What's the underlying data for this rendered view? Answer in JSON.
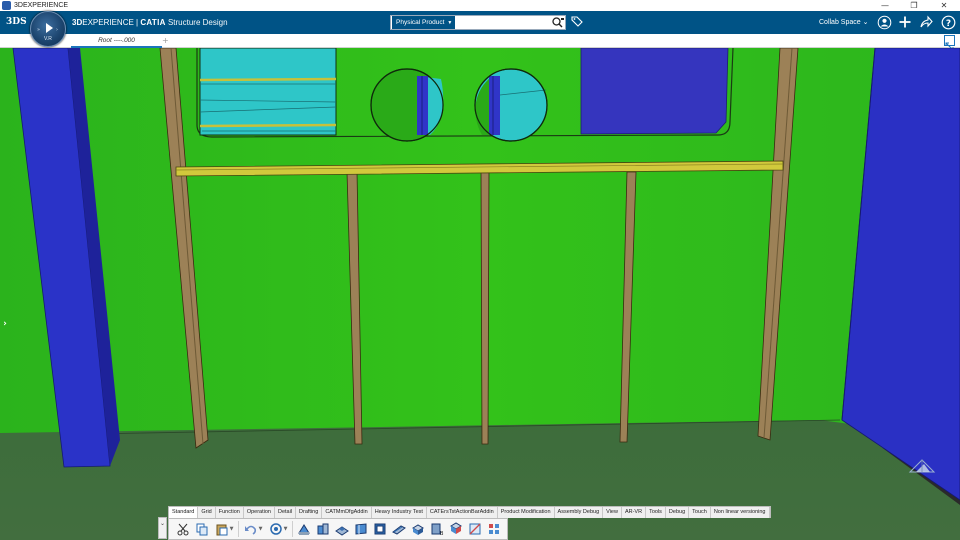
{
  "window": {
    "title": "3DEXPERIENCE",
    "controls": {
      "minimize": "—",
      "restore": "❐",
      "close": "✕"
    }
  },
  "topbar": {
    "brand_prefix": "3D",
    "brand_experience": "EXPERIENCE",
    "brand_separator": " | ",
    "brand_app": "CATIA",
    "brand_module": "Structure Design",
    "search": {
      "scope": "Physical Product",
      "placeholder": "",
      "value": ""
    },
    "collab_space": "Collab Space",
    "colors": {
      "bar": "#005386",
      "accent": "#1b75bb"
    }
  },
  "compass": {
    "label": "V.R"
  },
  "tabs": [
    {
      "label": "Root ----.000"
    }
  ],
  "tab_add": "+",
  "action_bar": {
    "tabs": [
      {
        "label": "Standard",
        "active": true
      },
      {
        "label": "Grid"
      },
      {
        "label": "Function"
      },
      {
        "label": "Operation"
      },
      {
        "label": "Detail"
      },
      {
        "label": "Drafting"
      },
      {
        "label": "CATMmDfgAddin"
      },
      {
        "label": "Heavy Industry Test"
      },
      {
        "label": "CATErsTstActionBarAddin"
      },
      {
        "label": "Product Modification"
      },
      {
        "label": "Assembly Debug"
      },
      {
        "label": "View"
      },
      {
        "label": "AR-VR"
      },
      {
        "label": "Tools"
      },
      {
        "label": "Debug"
      },
      {
        "label": "Touch"
      },
      {
        "label": "Non linear versioning"
      }
    ],
    "tools": [
      "cut-icon",
      "copy-icon",
      "paste-icon",
      "undo-icon",
      "update-icon",
      "part-icon",
      "assembly-icon",
      "transform-icon",
      "plate-icon",
      "stiffener-icon",
      "member-icon",
      "profile-icon",
      "bracket-icon",
      "opening-icon",
      "split-icon",
      "manage-icon"
    ]
  },
  "scene": {
    "colors": {
      "wall": "#2fbb1a",
      "floor": "#3f6f3a",
      "blue_panel": "#2a2fc4",
      "stiffener": "#9a7f5a",
      "beam": "#cfc43a",
      "glass": "#2fc9c9"
    }
  }
}
